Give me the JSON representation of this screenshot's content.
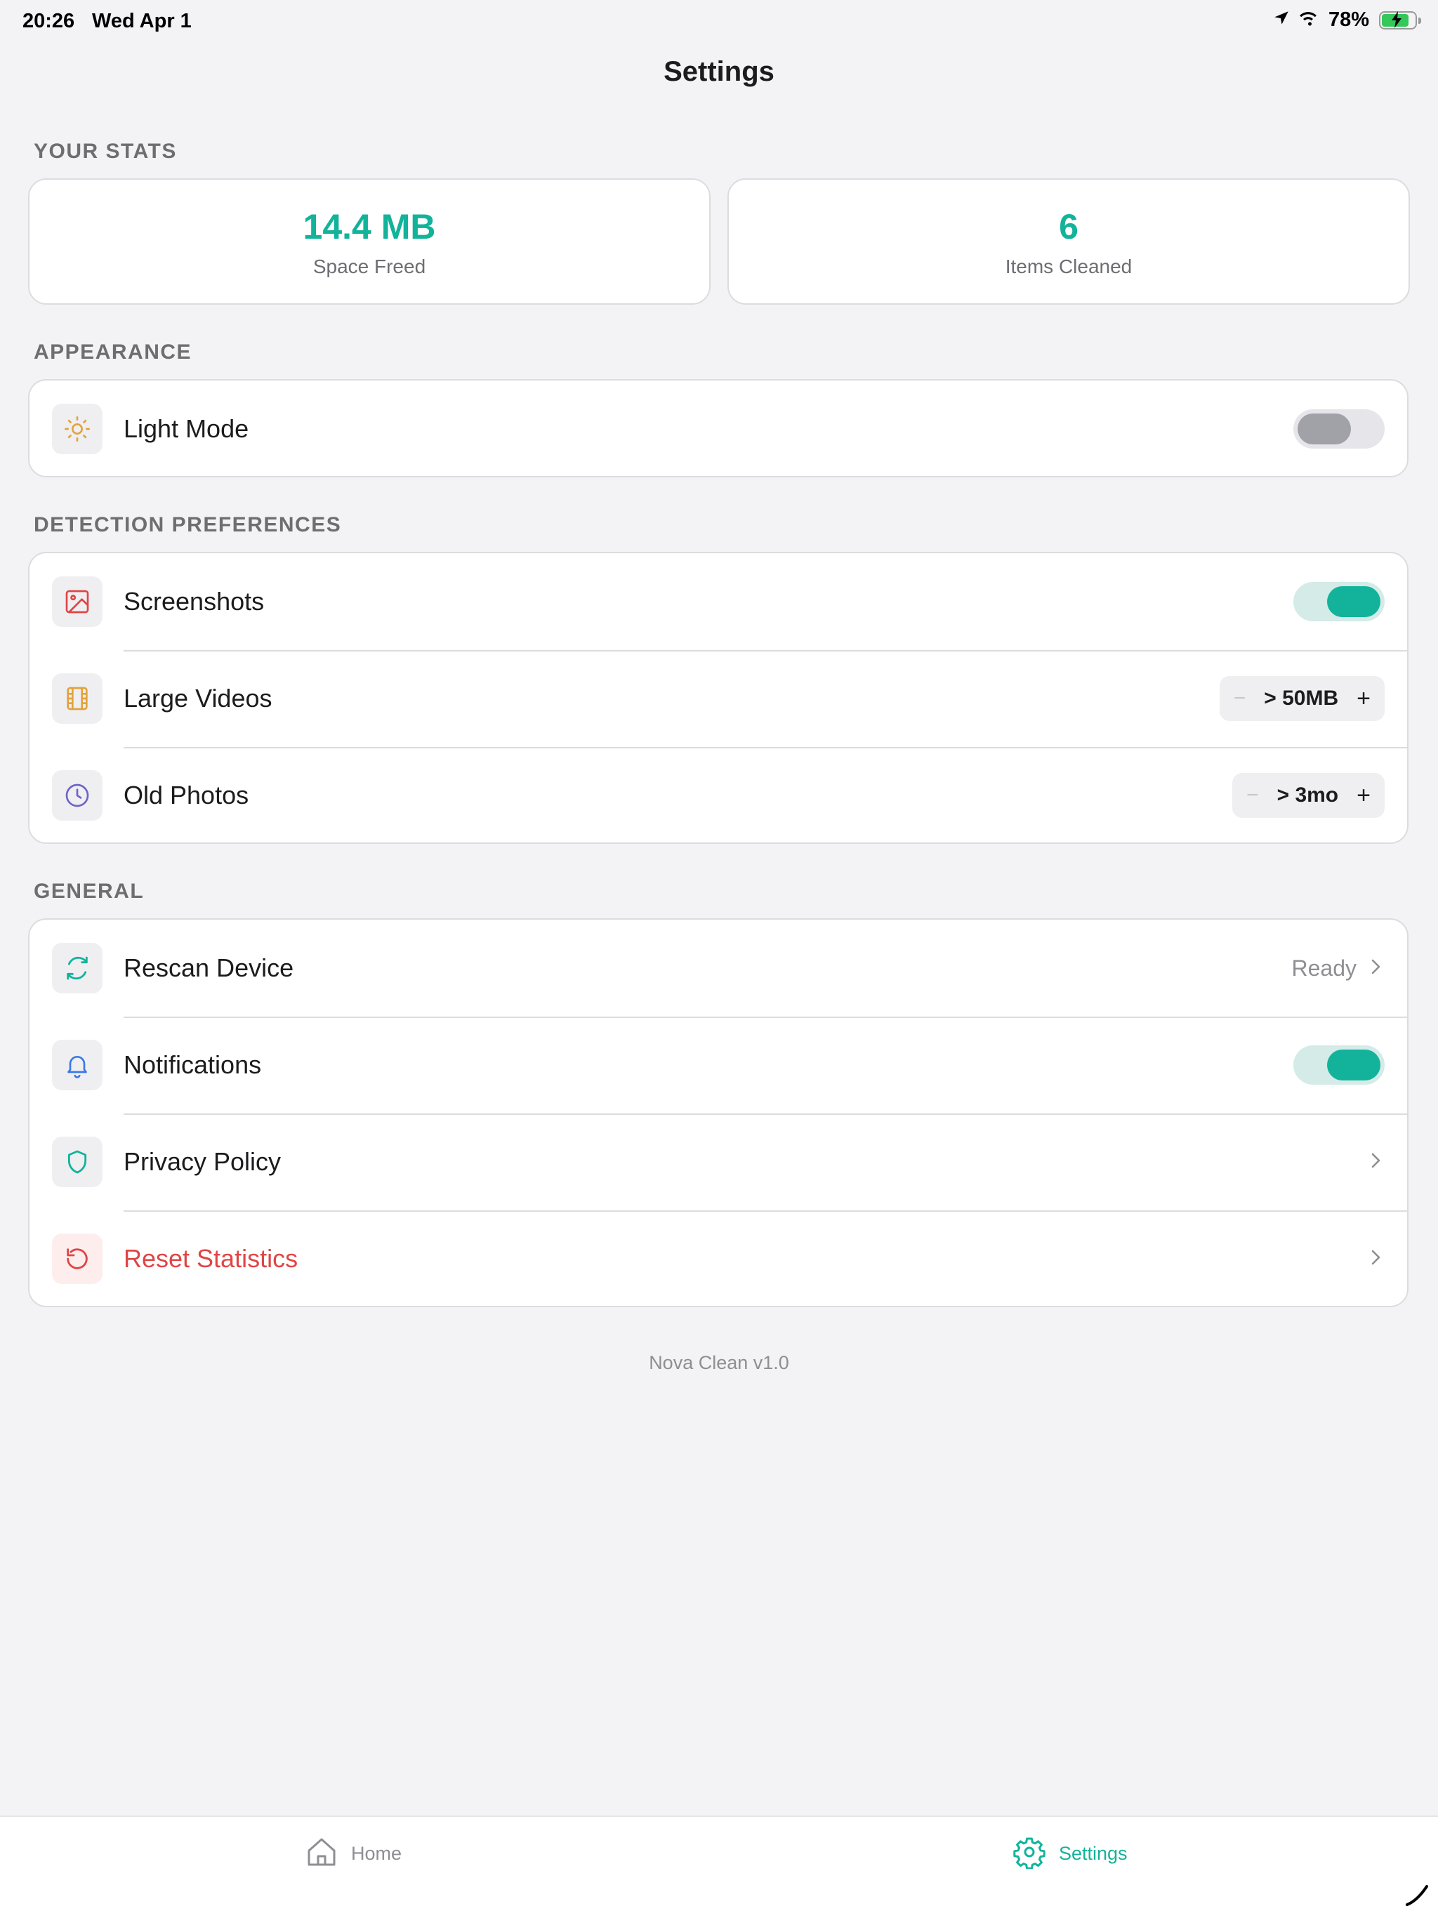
{
  "status_bar": {
    "time": "20:26",
    "date": "Wed Apr 1",
    "battery": "78%"
  },
  "nav": {
    "title": "Settings"
  },
  "stats": {
    "header": "YOUR STATS",
    "space_freed": {
      "value": "14.4 MB",
      "label": "Space Freed"
    },
    "items_cleaned": {
      "value": "6",
      "label": "Items Cleaned"
    }
  },
  "appearance": {
    "header": "APPEARANCE",
    "light_mode": {
      "label": "Light Mode",
      "enabled": false,
      "icon": "sun-icon"
    }
  },
  "detection": {
    "header": "DETECTION PREFERENCES",
    "screenshots": {
      "label": "Screenshots",
      "enabled": true,
      "icon": "image-icon"
    },
    "large_videos": {
      "label": "Large Videos",
      "value": "> 50MB",
      "minus": "−",
      "plus": "+",
      "icon": "film-icon"
    },
    "old_photos": {
      "label": "Old Photos",
      "value": "> 3mo",
      "minus": "−",
      "plus": "+",
      "icon": "clock-icon"
    }
  },
  "general": {
    "header": "GENERAL",
    "rescan": {
      "label": "Rescan Device",
      "status": "Ready",
      "icon": "refresh-icon"
    },
    "notifications": {
      "label": "Notifications",
      "enabled": true,
      "icon": "bell-icon"
    },
    "privacy": {
      "label": "Privacy Policy",
      "icon": "shield-icon"
    },
    "reset": {
      "label": "Reset Statistics",
      "icon": "reset-icon"
    }
  },
  "footer": {
    "version": "Nova Clean v1.0"
  },
  "tab_bar": {
    "home": {
      "label": "Home",
      "icon": "home-icon",
      "selected": false
    },
    "settings": {
      "label": "Settings",
      "icon": "gear-icon",
      "selected": true
    }
  },
  "colors": {
    "accent": "#12b39a",
    "danger": "#e04545",
    "background": "#f3f3f5",
    "warning": "#e3a23b",
    "purple": "#6e64c8",
    "blue": "#3a78e6"
  }
}
